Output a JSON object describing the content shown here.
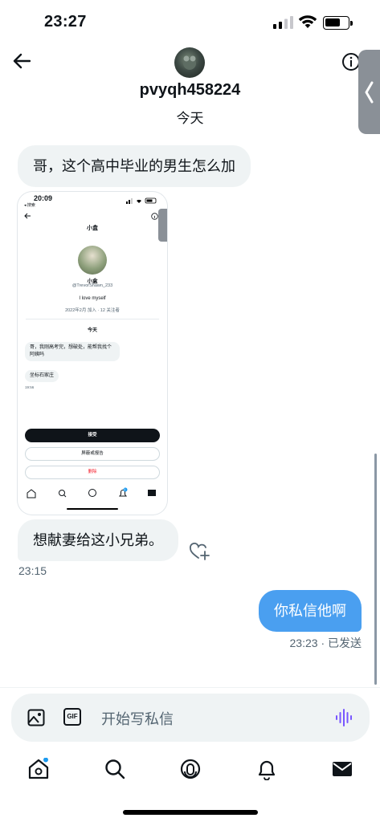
{
  "status_bar": {
    "time": "23:27"
  },
  "header": {
    "username": "pvyqh458224",
    "day_label": "今天"
  },
  "messages": {
    "incoming_1": "哥，这个高中毕业的男生怎么加",
    "incoming_2": "想献妻给这小兄弟。",
    "incoming_2_time": "23:15",
    "outgoing_1": "你私信他啊",
    "outgoing_1_status": "23:23 · 已发送"
  },
  "embedded_screenshot": {
    "time": "20:09",
    "back_label": "◂ 搜索",
    "title": "小盒",
    "name": "小盒",
    "handle": "@TrevorShawn_233",
    "bio": "I love myself",
    "joined": "2022年2月 加入 · 12 关注者",
    "day_label": "今天",
    "msg_1": "哥，我刚高考完，想破处，能帮我找个阿姨吗",
    "msg_2": "坐标石家庄",
    "msg_time": "19:56",
    "accept_label": "接受",
    "block_label": "屏蔽或报告",
    "delete_label": "删除",
    "notification_badge": "1"
  },
  "composer": {
    "placeholder": "开始写私信",
    "gif_label": "GIF"
  },
  "colors": {
    "accent": "#1d9bf0",
    "outgoing_bubble": "#4a9ff0",
    "voice_icon": "#7856ff",
    "notification_dot": "#1d9bf0"
  },
  "icons": {
    "header": [
      "back-arrow-icon",
      "info-icon",
      "chevron-left-icon"
    ],
    "composer": [
      "image-icon",
      "gif-icon",
      "voice-icon"
    ],
    "tab_bar": [
      "home-icon",
      "search-icon",
      "spaces-icon",
      "bell-icon",
      "mail-icon"
    ]
  }
}
